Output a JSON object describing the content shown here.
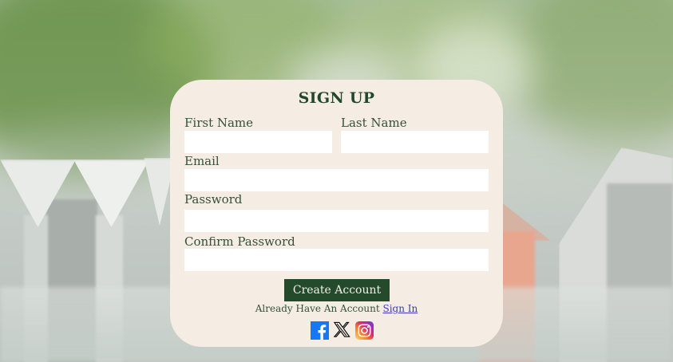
{
  "form": {
    "title": "SIGN UP",
    "first_name_label": "First Name",
    "first_name_value": "",
    "last_name_label": "Last Name",
    "last_name_value": "",
    "email_label": "Email",
    "email_value": "",
    "password_label": "Password",
    "password_value": "",
    "confirm_password_label": "Confirm Password",
    "confirm_password_value": "",
    "submit_label": "Create Account",
    "already_text": "Already Have An Account",
    "signin_label": "Sign In"
  },
  "social": [
    {
      "icon": "facebook-icon",
      "color": "#1877f2"
    },
    {
      "icon": "x-icon",
      "color": "#000000"
    },
    {
      "icon": "instagram-icon",
      "color": "#e1306c"
    }
  ],
  "colors": {
    "card_bg": "#f5ede4",
    "accent": "#234a2b",
    "link": "#3d3bb8"
  }
}
